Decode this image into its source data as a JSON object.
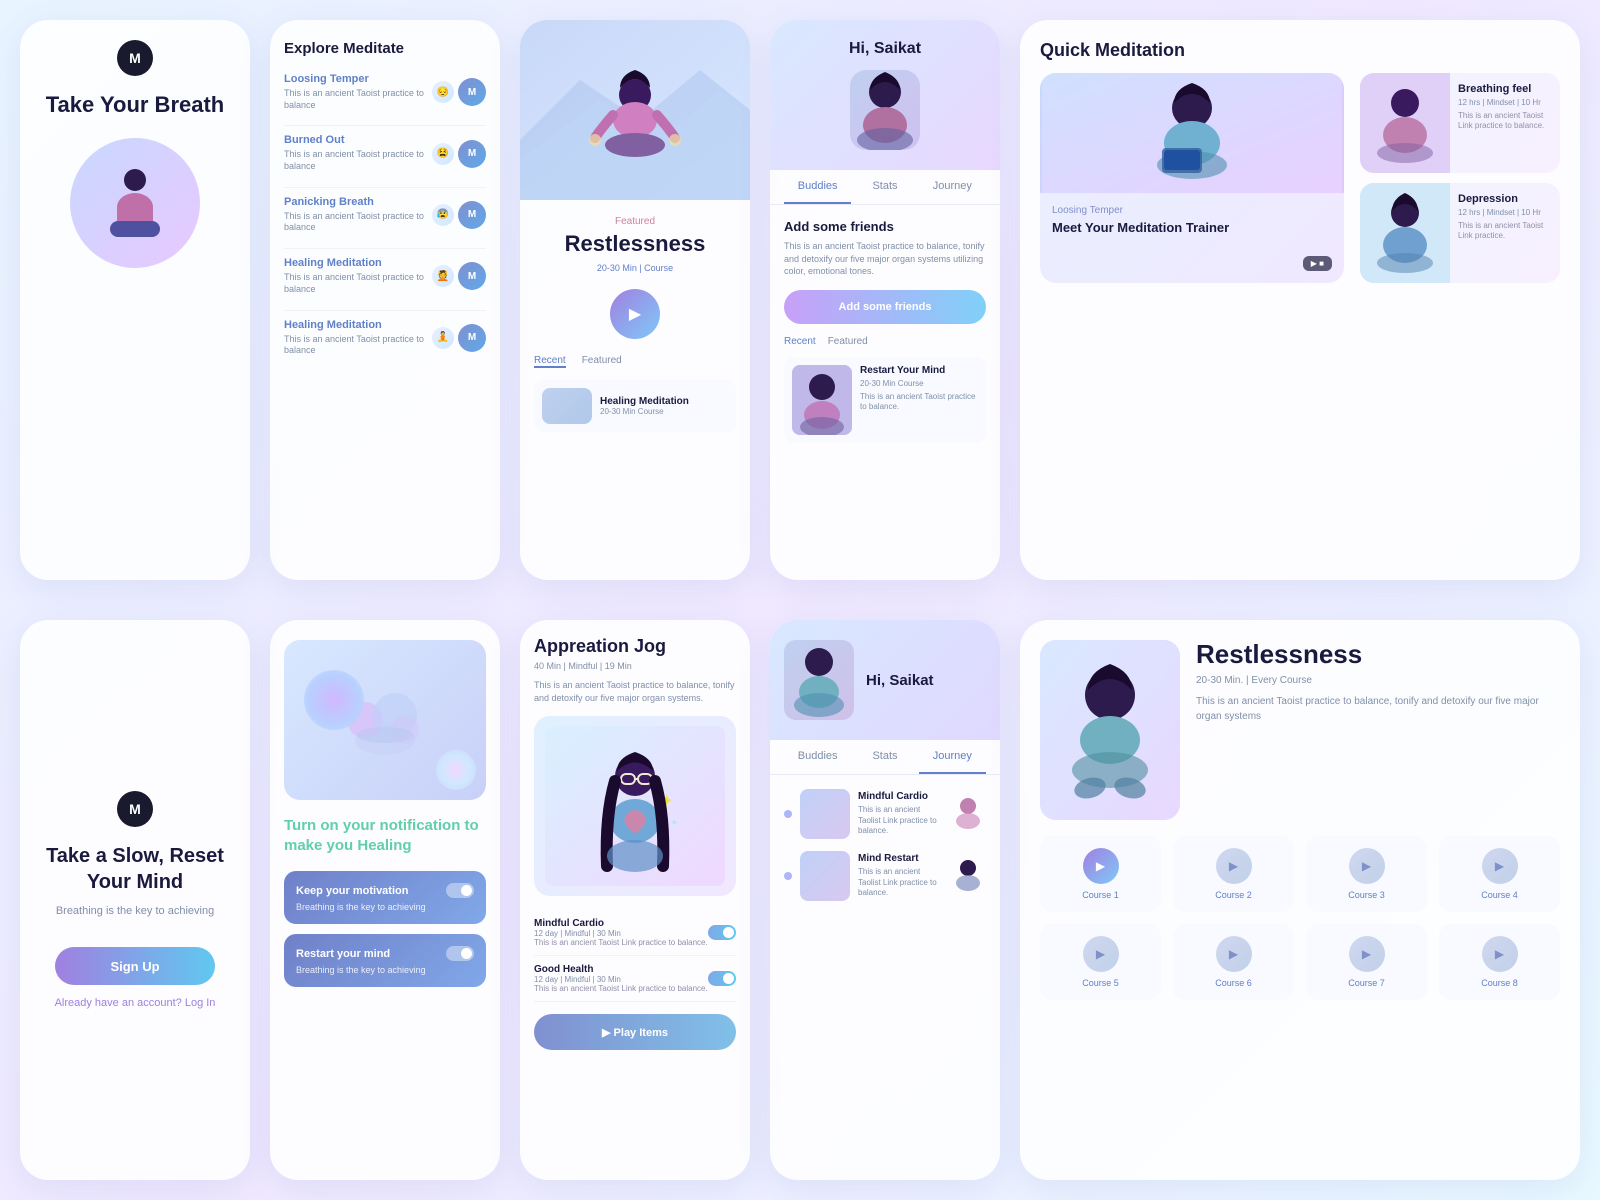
{
  "screens": {
    "screen1": {
      "title": "Take Your Breath",
      "logo": "M"
    },
    "screen2": {
      "title": "Take a Slow, Reset Your Mind",
      "subtitle": "Breathing is the key to achieving",
      "signup": "Sign Up",
      "login_prompt": "Already have an account?",
      "login_link": "Log In"
    },
    "screen3": {
      "title": "Explore Meditate",
      "items": [
        {
          "name": "Loosing Temper",
          "desc": "This is an ancient Taoist practice to balance"
        },
        {
          "name": "Burned Out",
          "desc": "This is an ancient Taoist practice to balance"
        },
        {
          "name": "Panicking Breath",
          "desc": "This is an ancient Taoist practice to balance"
        },
        {
          "name": "Healing Meditation",
          "desc": "This is an ancient Taoist practice to balance"
        },
        {
          "name": "Healing Meditation",
          "desc": "This is an ancient Taoist practice to balance"
        }
      ]
    },
    "screen4": {
      "title": "Turn on your notification to make you",
      "highlight": "Healing",
      "cards": [
        {
          "title": "Keep your motivation",
          "desc": "Breathing is the key to achieving"
        },
        {
          "title": "Restart your mind",
          "desc": "Breathing is the key to achieving"
        }
      ]
    },
    "screen5": {
      "featured_label": "Featured",
      "featured_title": "Restlessness",
      "featured_meta": "20-30 Min | Course",
      "tab_recent": "Recent",
      "tab_featured": "Featured",
      "mini_title": "Healing Meditation",
      "mini_meta": "20-30 Min Course"
    },
    "screen6": {
      "title": "Appreation Jog",
      "meta": "40 Min | Mindful | 19 Min",
      "desc": "This is an ancient Taoist practice to balance, tonify and detoxify our five major organ systems.",
      "courses": [
        {
          "name": "Mindful Cardio",
          "meta": "12 day | Mindful | 30 Min"
        },
        {
          "name": "Good Health",
          "meta": "12 day | Mindful | 30 Min"
        }
      ],
      "play_btn": "▶  Play Items"
    },
    "screen7": {
      "greeting": "Hi, Saikat",
      "tabs": [
        "Buddies",
        "Stats",
        "Journey"
      ],
      "add_friends_title": "Add some friends",
      "add_friends_desc": "This is an ancient Taoist practice to balance, tonify and detoxify our five major organ systems utilizing color, emotional tones.",
      "add_btn": "Add some friends",
      "tab_recent": "Recent",
      "tab_featured": "Featured",
      "restart_title": "Restart Your Mind",
      "restart_meta": "20-30 Min Course",
      "restart_desc": "This is an ancient Taoist practice to balance."
    },
    "screen8": {
      "greeting": "Hi, Saikat",
      "tabs": [
        "Buddies",
        "Stats",
        "Journey"
      ],
      "items": [
        {
          "name": "Mindful Cardio",
          "desc": "This is an ancient Taolist Link practice to balance."
        },
        {
          "name": "Mind Restart",
          "desc": "This is an ancient Taolist Link practice to balance."
        }
      ]
    },
    "screen9": {
      "title": "Quick Meditation",
      "main_label": "Loosing Temper",
      "main_title": "Meet Your Meditation Trainer",
      "video_label": "▶ ■",
      "cards": [
        {
          "name": "Breathing feel",
          "meta": "12 hrs | Mindset | 10 Hr",
          "desc": "This is an ancient Taoist Link practice to balance."
        },
        {
          "name": "Depression",
          "meta": "12 hrs | Mindset | 10 Hr",
          "desc": "This is an ancient Taoist Link practice."
        }
      ]
    },
    "screen10": {
      "title": "Restlessness",
      "meta": "20-30 Min. | Every Course",
      "desc": "This is an ancient Taoist practice to balance, tonify and detoxify our five major organ systems",
      "courses": [
        "Course 1",
        "Course 2",
        "Course 3",
        "Course 4",
        "Course 5",
        "Course 6",
        "Course 7",
        "Course 8"
      ]
    }
  }
}
